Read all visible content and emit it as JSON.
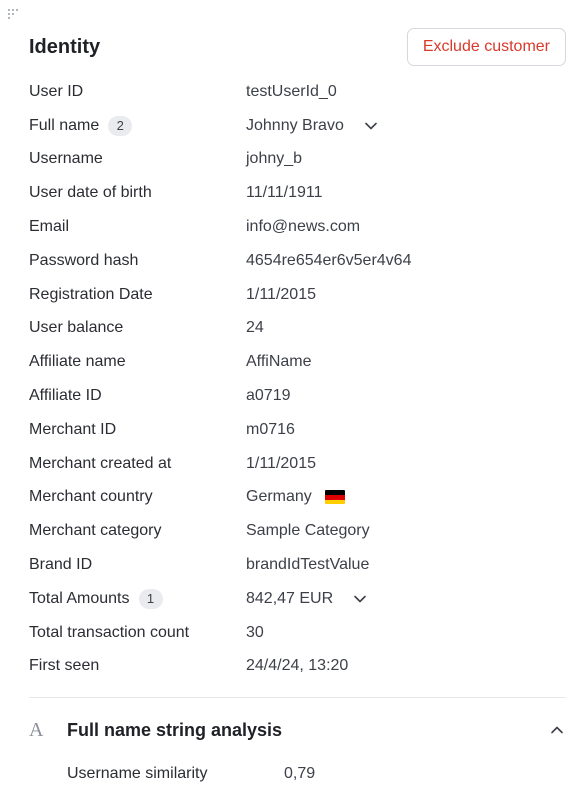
{
  "identity": {
    "title": "Identity",
    "exclude_button": "Exclude customer",
    "rows": [
      {
        "label": "User ID",
        "value": "testUserId_0"
      },
      {
        "label": "Full name",
        "badge": "2",
        "value": "Johnny Bravo"
      },
      {
        "label": "Username",
        "value": "johny_b"
      },
      {
        "label": "User date of birth",
        "value": "11/11/1911"
      },
      {
        "label": "Email",
        "value": "info@news.com"
      },
      {
        "label": "Password hash",
        "value": "4654re654er6v5er4v64"
      },
      {
        "label": "Registration Date",
        "value": "1/11/2015"
      },
      {
        "label": "User balance",
        "value": "24"
      },
      {
        "label": "Affiliate name",
        "value": "AffiName"
      },
      {
        "label": "Affiliate ID",
        "value": "a0719"
      },
      {
        "label": "Merchant ID",
        "value": "m0716"
      },
      {
        "label": "Merchant created at",
        "value": "1/11/2015"
      },
      {
        "label": "Merchant country",
        "value": "Germany",
        "flag_icon": "germany-flag-icon"
      },
      {
        "label": "Merchant category",
        "value": "Sample Category"
      },
      {
        "label": "Brand ID",
        "value": "brandIdTestValue"
      },
      {
        "label": "Total Amounts",
        "badge": "1",
        "value": "842,47 EUR"
      },
      {
        "label": "Total transaction count",
        "value": "30"
      },
      {
        "label": "First seen",
        "value": "24/4/24, 13:20"
      }
    ]
  },
  "string_analysis": {
    "icon": "text-format-icon",
    "icon_glyph": "A",
    "title": "Full name string analysis",
    "rows": [
      {
        "label": "Username similarity",
        "value": "0,79"
      }
    ]
  },
  "colors": {
    "danger": "#d93a2b",
    "flag": [
      "#000000",
      "#dd0000",
      "#ffce00"
    ]
  }
}
